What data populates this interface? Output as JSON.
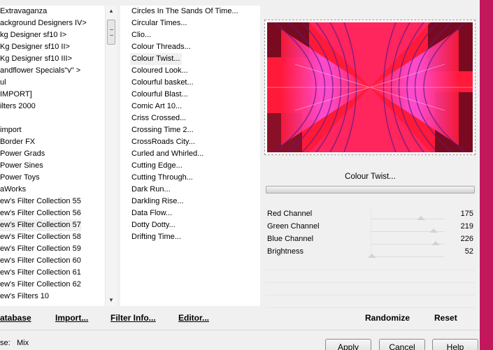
{
  "categories": [
    {
      "label": " Extravaganza"
    },
    {
      "label": "ackground Designers IV>"
    },
    {
      "label": "kg Designer sf10 I>"
    },
    {
      "label": "Kg Designer sf10 II>"
    },
    {
      "label": "Kg Designer sf10 III>"
    },
    {
      "label": "andflower Specials\"v\" >"
    },
    {
      "label": "ul"
    },
    {
      "label": " IMPORT]"
    },
    {
      "label": "ilters 2000"
    },
    {
      "label": ""
    },
    {
      "label": "import"
    },
    {
      "label": " Border FX"
    },
    {
      "label": " Power Grads"
    },
    {
      "label": " Power Sines"
    },
    {
      "label": " Power Toys"
    },
    {
      "label": "aWorks"
    },
    {
      "label": "ew's Filter Collection 55"
    },
    {
      "label": "ew's Filter Collection 56"
    },
    {
      "label": "ew's Filter Collection 57",
      "selected": true
    },
    {
      "label": "ew's Filter Collection 58"
    },
    {
      "label": "ew's Filter Collection 59"
    },
    {
      "label": "ew's Filter Collection 60"
    },
    {
      "label": "ew's Filter Collection 61"
    },
    {
      "label": "ew's Filter Collection 62"
    },
    {
      "label": "ew's Filters 10"
    }
  ],
  "filters": [
    {
      "label": "Circles In The Sands Of Time..."
    },
    {
      "label": "Circular Times..."
    },
    {
      "label": "Clio..."
    },
    {
      "label": "Colour Threads..."
    },
    {
      "label": "Colour Twist...",
      "selected": true
    },
    {
      "label": "Coloured Look..."
    },
    {
      "label": "Colourful basket..."
    },
    {
      "label": "Colourful Blast..."
    },
    {
      "label": "Comic Art 10..."
    },
    {
      "label": "Criss Crossed..."
    },
    {
      "label": "Crossing Time 2..."
    },
    {
      "label": "CrossRoads City..."
    },
    {
      "label": "Curled and Whirled..."
    },
    {
      "label": "Cutting Edge..."
    },
    {
      "label": "Cutting Through..."
    },
    {
      "label": "Dark Run..."
    },
    {
      "label": "Darkling Rise..."
    },
    {
      "label": "Data Flow..."
    },
    {
      "label": "Dotty Dotty..."
    },
    {
      "label": "Drifting Time..."
    }
  ],
  "effect_name": "Colour Twist...",
  "params": [
    {
      "name": "Red Channel",
      "value": "175",
      "fraction": 0.686
    },
    {
      "name": "Green Channel",
      "value": "219",
      "fraction": 0.859
    },
    {
      "name": "Blue Channel",
      "value": "226",
      "fraction": 0.886
    },
    {
      "name": "Brightness",
      "value": "52",
      "fraction": 0.02
    }
  ],
  "buttons": {
    "database": "atabase",
    "import": "Import...",
    "filter_info": "Filter Info...",
    "editor": "Editor...",
    "randomize": "Randomize",
    "reset": "Reset",
    "apply": "Apply",
    "cancel": "Cancel",
    "help": "Help"
  },
  "info": {
    "label": "se:",
    "value": "Mix"
  },
  "icons": {
    "scroll_up": "scroll-up-arrow",
    "scroll_down": "scroll-down-arrow"
  },
  "colors": {
    "accent": "#c2185b",
    "preview_red": "#ff1a3a",
    "preview_pink": "#ff4fd8",
    "preview_maroon": "#7a0a1f"
  }
}
